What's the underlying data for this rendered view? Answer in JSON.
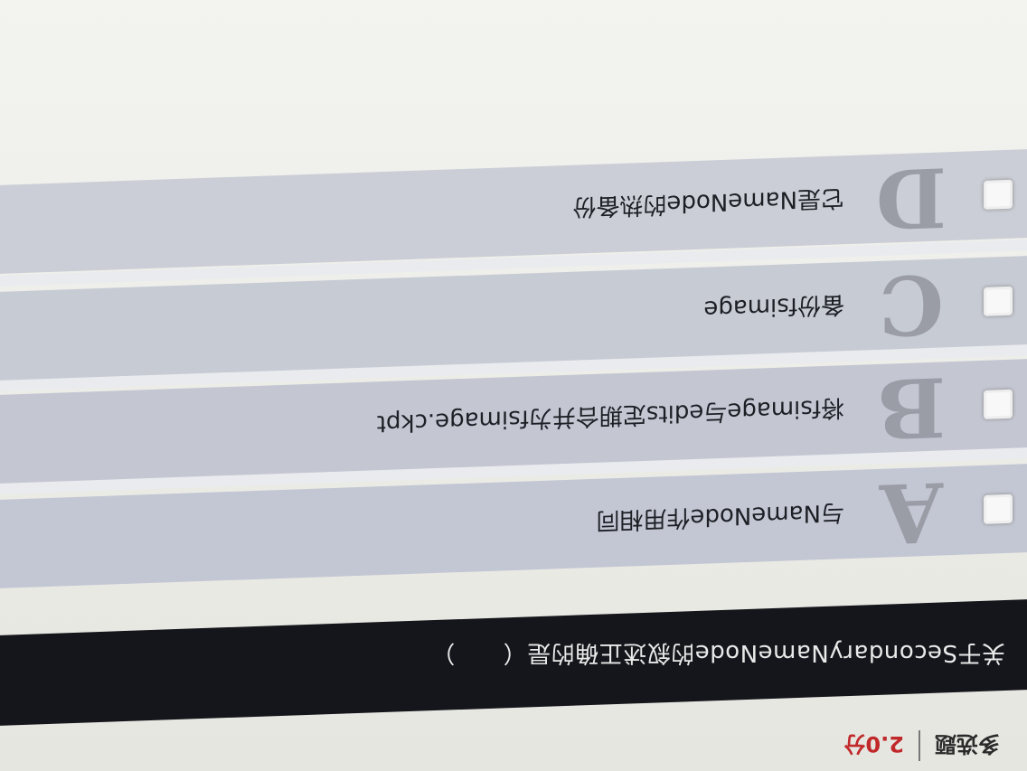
{
  "header": {
    "type": "多选题",
    "score": "2.0分"
  },
  "question": {
    "text": "关于SecondaryNameNode的叙述正确的是（　　）"
  },
  "options": [
    {
      "letter": "A",
      "text": "与NameNode作用相同"
    },
    {
      "letter": "B",
      "text": "将fsimage与edits定期合并为fsimage.ckpt"
    },
    {
      "letter": "C",
      "text": "备份fsimage"
    },
    {
      "letter": "D",
      "text": "它是NameNode的热备份"
    }
  ],
  "colors": {
    "question_bg": "#14161b",
    "score": "#c0282a",
    "option_bg": "#c8ccd6"
  }
}
